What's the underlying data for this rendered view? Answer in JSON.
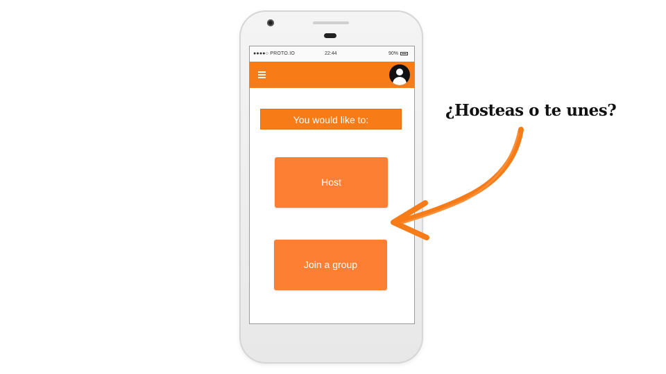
{
  "phone": {
    "status_bar": {
      "carrier": "●●●●○ PROTO.IO",
      "time": "22:44",
      "battery": "90%"
    },
    "app_bar": {
      "menu_icon": "hamburger-menu-icon",
      "avatar_icon": "user-avatar-icon"
    },
    "prompt": "You would like to:",
    "buttons": {
      "host": "Host",
      "join": "Join a group"
    }
  },
  "annotation": {
    "text": "¿Hosteas o te unes?",
    "arrow_color": "#f77b17"
  },
  "colors": {
    "accent": "#f77b17",
    "button": "#fd7f34"
  }
}
